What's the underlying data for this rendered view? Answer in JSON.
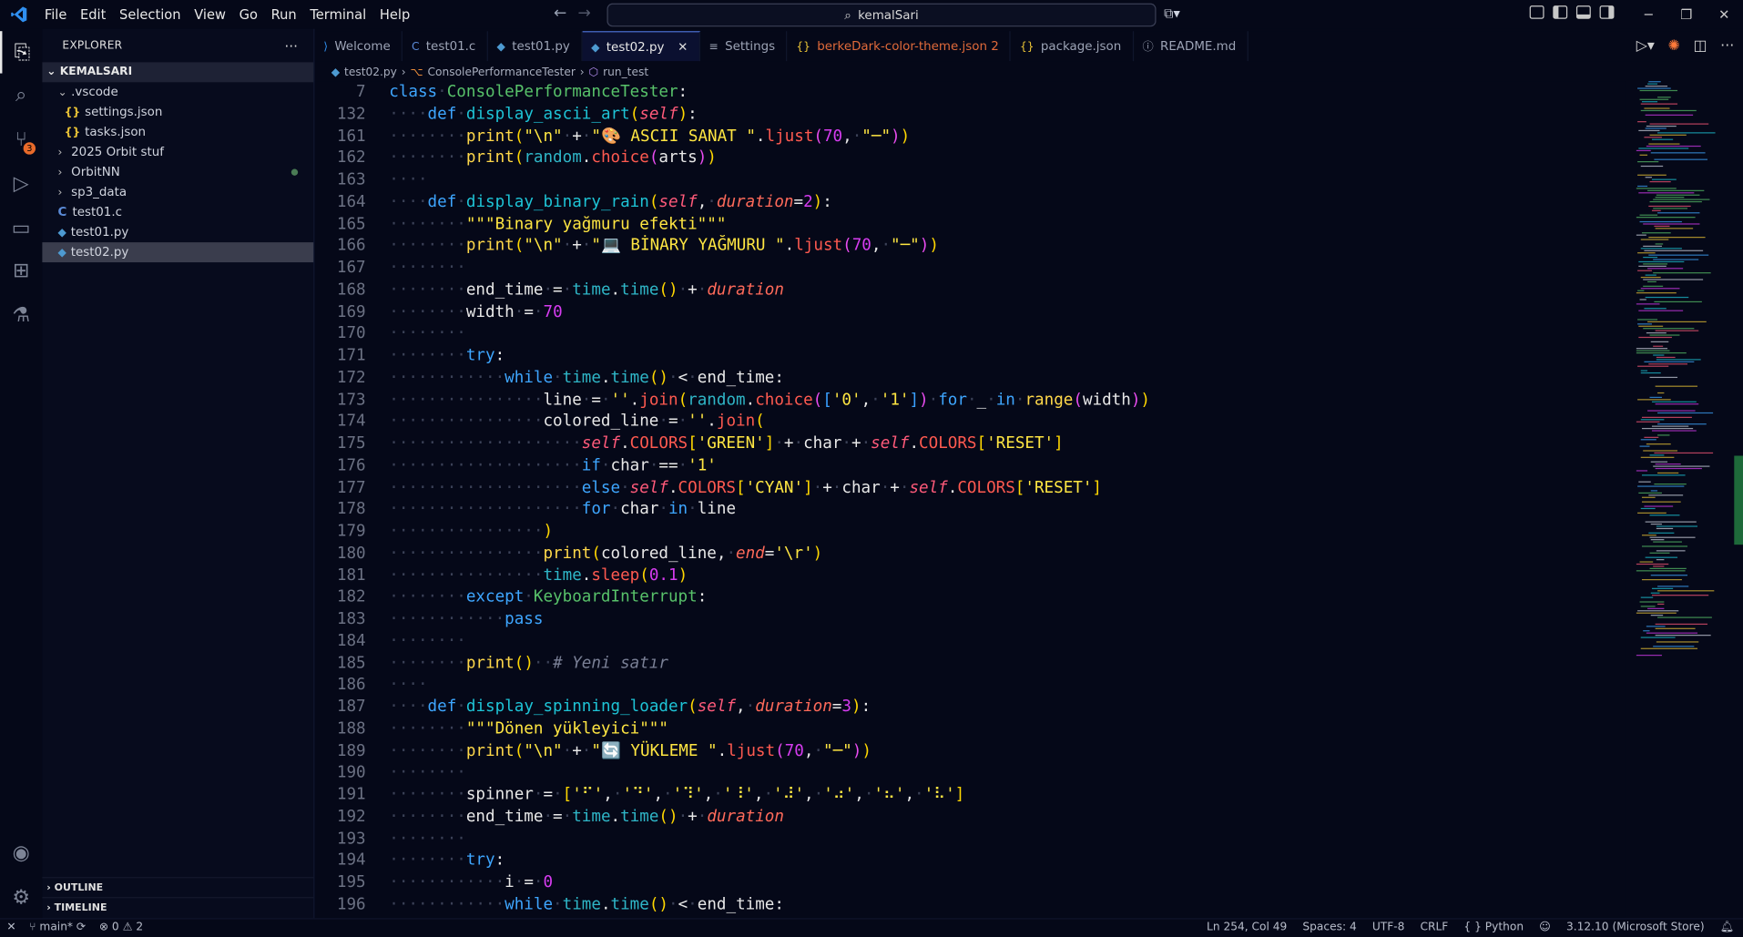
{
  "menu": [
    "File",
    "Edit",
    "Selection",
    "View",
    "Go",
    "Run",
    "Terminal",
    "Help"
  ],
  "search": {
    "text": "kemalSari"
  },
  "explorer": {
    "title": "EXPLORER",
    "more": "···",
    "root": "KEMALSARI",
    "items": [
      {
        "label": ".vscode",
        "type": "folder-open",
        "indent": 1
      },
      {
        "label": "settings.json",
        "type": "json",
        "indent": 2
      },
      {
        "label": "tasks.json",
        "type": "json",
        "indent": 2
      },
      {
        "label": "2025 Orbit stuf",
        "type": "folder",
        "indent": 1
      },
      {
        "label": "OrbitNN",
        "type": "folder",
        "indent": 1,
        "dot": true
      },
      {
        "label": "sp3_data",
        "type": "folder",
        "indent": 1
      },
      {
        "label": "test01.c",
        "type": "c",
        "indent": 1
      },
      {
        "label": "test01.py",
        "type": "py",
        "indent": 1
      },
      {
        "label": "test02.py",
        "type": "py",
        "indent": 1,
        "selected": true
      }
    ],
    "outline": "OUTLINE",
    "timeline": "TIMELINE"
  },
  "tabs": [
    {
      "label": "Welcome",
      "icon": "vscode-icon"
    },
    {
      "label": "test01.c",
      "icon": "C"
    },
    {
      "label": "test01.py",
      "icon": "py"
    },
    {
      "label": "test02.py",
      "icon": "py",
      "active": true
    },
    {
      "label": "Settings",
      "icon": "≡"
    },
    {
      "label": "berkeDark-color-theme.json 2",
      "icon": "{}",
      "modified": true
    },
    {
      "label": "package.json",
      "icon": "{}"
    },
    {
      "label": "README.md",
      "icon": "ⓘ"
    }
  ],
  "breadcrumb": [
    "test02.py",
    "ConsolePerformanceTester",
    "run_test"
  ],
  "source_control_badge": "3",
  "status": {
    "branch": "main*",
    "errors": "0",
    "warnings": "2",
    "position": "Ln 254, Col 49",
    "spaces": "Spaces: 4",
    "encoding": "UTF-8",
    "eol": "CRLF",
    "language": "Python",
    "interpreter": "3.12.10 (Microsoft Store)"
  },
  "code_lines": [
    {
      "n": "7",
      "t": "class ConsolePerformanceTester:"
    },
    {
      "n": "132",
      "t": "    def display_ascii_art(self):"
    },
    {
      "n": "161",
      "t": "        print(\"\\n\" + \"🎨 ASCII SANAT \".ljust(70, \"─\"))"
    },
    {
      "n": "162",
      "t": "        print(random.choice(arts))"
    },
    {
      "n": "163",
      "t": "    "
    },
    {
      "n": "164",
      "t": "    def display_binary_rain(self, duration=2):"
    },
    {
      "n": "165",
      "t": "        \"\"\"Binary yağmuru efekti\"\"\""
    },
    {
      "n": "166",
      "t": "        print(\"\\n\" + \"💻 BİNARY YAĞMURU \".ljust(70, \"─\"))"
    },
    {
      "n": "167",
      "t": "        "
    },
    {
      "n": "168",
      "t": "        end_time = time.time() + duration"
    },
    {
      "n": "169",
      "t": "        width = 70"
    },
    {
      "n": "170",
      "t": "        "
    },
    {
      "n": "171",
      "t": "        try:"
    },
    {
      "n": "172",
      "t": "            while time.time() < end_time:"
    },
    {
      "n": "173",
      "t": "                line = ''.join(random.choice(['0', '1']) for _ in range(width))"
    },
    {
      "n": "174",
      "t": "                colored_line = ''.join("
    },
    {
      "n": "175",
      "t": "                    self.COLORS['GREEN'] + char + self.COLORS['RESET']"
    },
    {
      "n": "176",
      "t": "                    if char == '1'"
    },
    {
      "n": "177",
      "t": "                    else self.COLORS['CYAN'] + char + self.COLORS['RESET']"
    },
    {
      "n": "178",
      "t": "                    for char in line"
    },
    {
      "n": "179",
      "t": "                )"
    },
    {
      "n": "180",
      "t": "                print(colored_line, end='\\r')"
    },
    {
      "n": "181",
      "t": "                time.sleep(0.1)"
    },
    {
      "n": "182",
      "t": "        except KeyboardInterrupt:"
    },
    {
      "n": "183",
      "t": "            pass"
    },
    {
      "n": "184",
      "t": "        "
    },
    {
      "n": "185",
      "t": "        print()  # Yeni satır"
    },
    {
      "n": "186",
      "t": "    "
    },
    {
      "n": "187",
      "t": "    def display_spinning_loader(self, duration=3):"
    },
    {
      "n": "188",
      "t": "        \"\"\"Dönen yükleyici\"\"\""
    },
    {
      "n": "189",
      "t": "        print(\"\\n\" + \"🔄 YÜKLEME \".ljust(70, \"─\"))"
    },
    {
      "n": "190",
      "t": "        "
    },
    {
      "n": "191",
      "t": "        spinner = ['⠋', '⠙', '⠹', '⠸', '⠼', '⠴', '⠦', '⠧']"
    },
    {
      "n": "192",
      "t": "        end_time = time.time() + duration"
    },
    {
      "n": "193",
      "t": "        "
    },
    {
      "n": "194",
      "t": "        try:"
    },
    {
      "n": "195",
      "t": "            i = 0"
    },
    {
      "n": "196",
      "t": "            while time.time() < end_time:"
    }
  ]
}
